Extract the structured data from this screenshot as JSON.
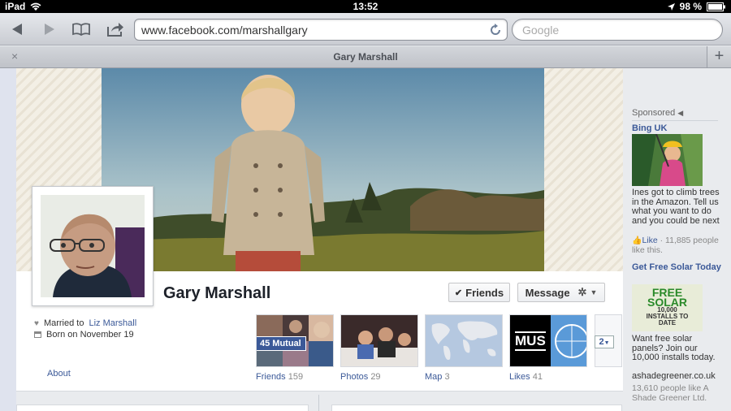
{
  "status_bar": {
    "device": "iPad",
    "time": "13:52",
    "battery": "98 %"
  },
  "browser": {
    "url": "www.facebook.com/marshallgary",
    "search_placeholder": "Google",
    "tab_title": "Gary Marshall",
    "tab_close": "×",
    "tab_add": "+"
  },
  "profile": {
    "name": "Gary Marshall",
    "friends_button": "Friends",
    "message_button": "Message",
    "married_prefix": "Married to",
    "married_link": "Liz Marshall",
    "born": "Born on November 19",
    "about_link": "About",
    "mutual_badge": "45 Mutual",
    "more_count": "2"
  },
  "tiles": [
    {
      "label": "Friends",
      "count": "159"
    },
    {
      "label": "Photos",
      "count": "29"
    },
    {
      "label": "Map",
      "count": "3"
    },
    {
      "label": "Likes",
      "count": "41"
    }
  ],
  "likes_tile_text": "MUS",
  "sponsored": {
    "header": "Sponsored",
    "ads": [
      {
        "title": "Bing UK",
        "body": "Ines got to climb trees in the Amazon. Tell us what you want to do and you could be next",
        "like_label": "Like",
        "meta": " · 11,885 people like this."
      },
      {
        "title": "Get Free Solar Today",
        "image_line1": "FREE",
        "image_line2": "SOLAR",
        "image_line3": "10,000",
        "image_line4": "INSTALLS TO",
        "image_line5": "DATE",
        "body": "Want free solar panels? Join our 10,000 installs today.",
        "domain": "ashadegreener.co.uk",
        "meta": "13,610 people like A Shade Greener Ltd."
      }
    ]
  },
  "colors": {
    "fb_blue": "#3b5998",
    "mutual_badge": "#3b5998"
  }
}
